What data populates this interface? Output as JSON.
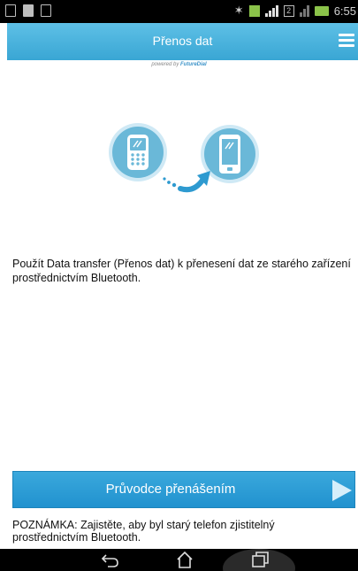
{
  "status_bar": {
    "time": "6:55",
    "sim_label": "2",
    "icons": [
      "gallery-icon",
      "document-icon",
      "screen-icon",
      "mute-icon",
      "data-icon",
      "signal-icon",
      "sim-icon",
      "signal-icon",
      "battery-icon"
    ]
  },
  "header": {
    "title": "Přenos dat",
    "menu_icon": "hamburger-menu-icon"
  },
  "powered": {
    "prefix": "powered by",
    "brand": "FutureDial"
  },
  "illustration": {
    "old_phone": "old-phone-icon",
    "new_phone": "smartphone-icon",
    "arrow": "transfer-arrow-icon"
  },
  "main": {
    "description": "Použít Data transfer (Přenos dat) k přenesení dat ze starého zařízení prostřednictvím Bluetooth."
  },
  "wizard_button": {
    "label": "Průvodce přenášením"
  },
  "note": {
    "text": "POZNÁMKA: Zajistěte, aby byl starý telefon zjistitelný prostřednictvím Bluetooth."
  },
  "nav_bar": {
    "buttons": [
      "back-icon",
      "home-icon",
      "recent-apps-icon"
    ]
  },
  "colors": {
    "header": "#39a6d4",
    "button": "#2192cf",
    "icon_circle": "#6ab8d8"
  }
}
